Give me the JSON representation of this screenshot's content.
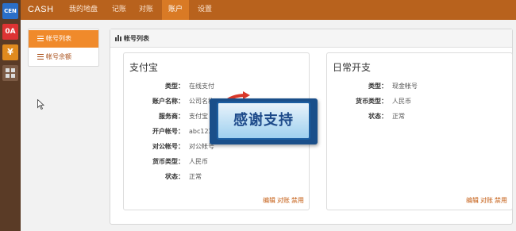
{
  "rail": {
    "items": [
      {
        "label": "CEN",
        "color": "#2a6fc9"
      },
      {
        "label": "0A",
        "color": "#d33"
      },
      {
        "label": "¥",
        "color": "#e08a1e"
      },
      {
        "label": "",
        "color": "#7b5a44"
      }
    ]
  },
  "header": {
    "brand": "CASH",
    "nav": [
      "我的地盘",
      "记账",
      "对账",
      "账户",
      "设置"
    ],
    "active": "账户"
  },
  "sidebar": {
    "items": [
      {
        "label": "帐号列表",
        "active": true
      },
      {
        "label": "帐号余额",
        "active": false
      }
    ]
  },
  "panel": {
    "title": "帐号列表"
  },
  "cards": [
    {
      "title": "支付宝",
      "rows": [
        {
          "key": "类型：",
          "value": "在线支付"
        },
        {
          "key": "账户名称：",
          "value": "公司名称"
        },
        {
          "key": "服务商：",
          "value": "支付宝"
        },
        {
          "key": "开户帐号：",
          "value": "abc123@"
        },
        {
          "key": "对公帐号：",
          "value": "对公帐号"
        },
        {
          "key": "货币类型：",
          "value": "人民币"
        },
        {
          "key": "状态：",
          "value": "正常"
        }
      ],
      "actions": [
        "编辑",
        "对账",
        "禁用"
      ]
    },
    {
      "title": "日常开支",
      "rows": [
        {
          "key": "类型：",
          "value": "现金帐号"
        },
        {
          "key": "货币类型：",
          "value": "人民币"
        },
        {
          "key": "状态：",
          "value": "正常"
        }
      ],
      "actions": [
        "编辑",
        "对账",
        "禁用"
      ]
    }
  ],
  "promo": {
    "label": "感谢支持"
  },
  "colors": {
    "accent": "#f08a2b",
    "topbar": "#b8621d",
    "rail": "#5a3b26",
    "link": "#c45c12"
  }
}
